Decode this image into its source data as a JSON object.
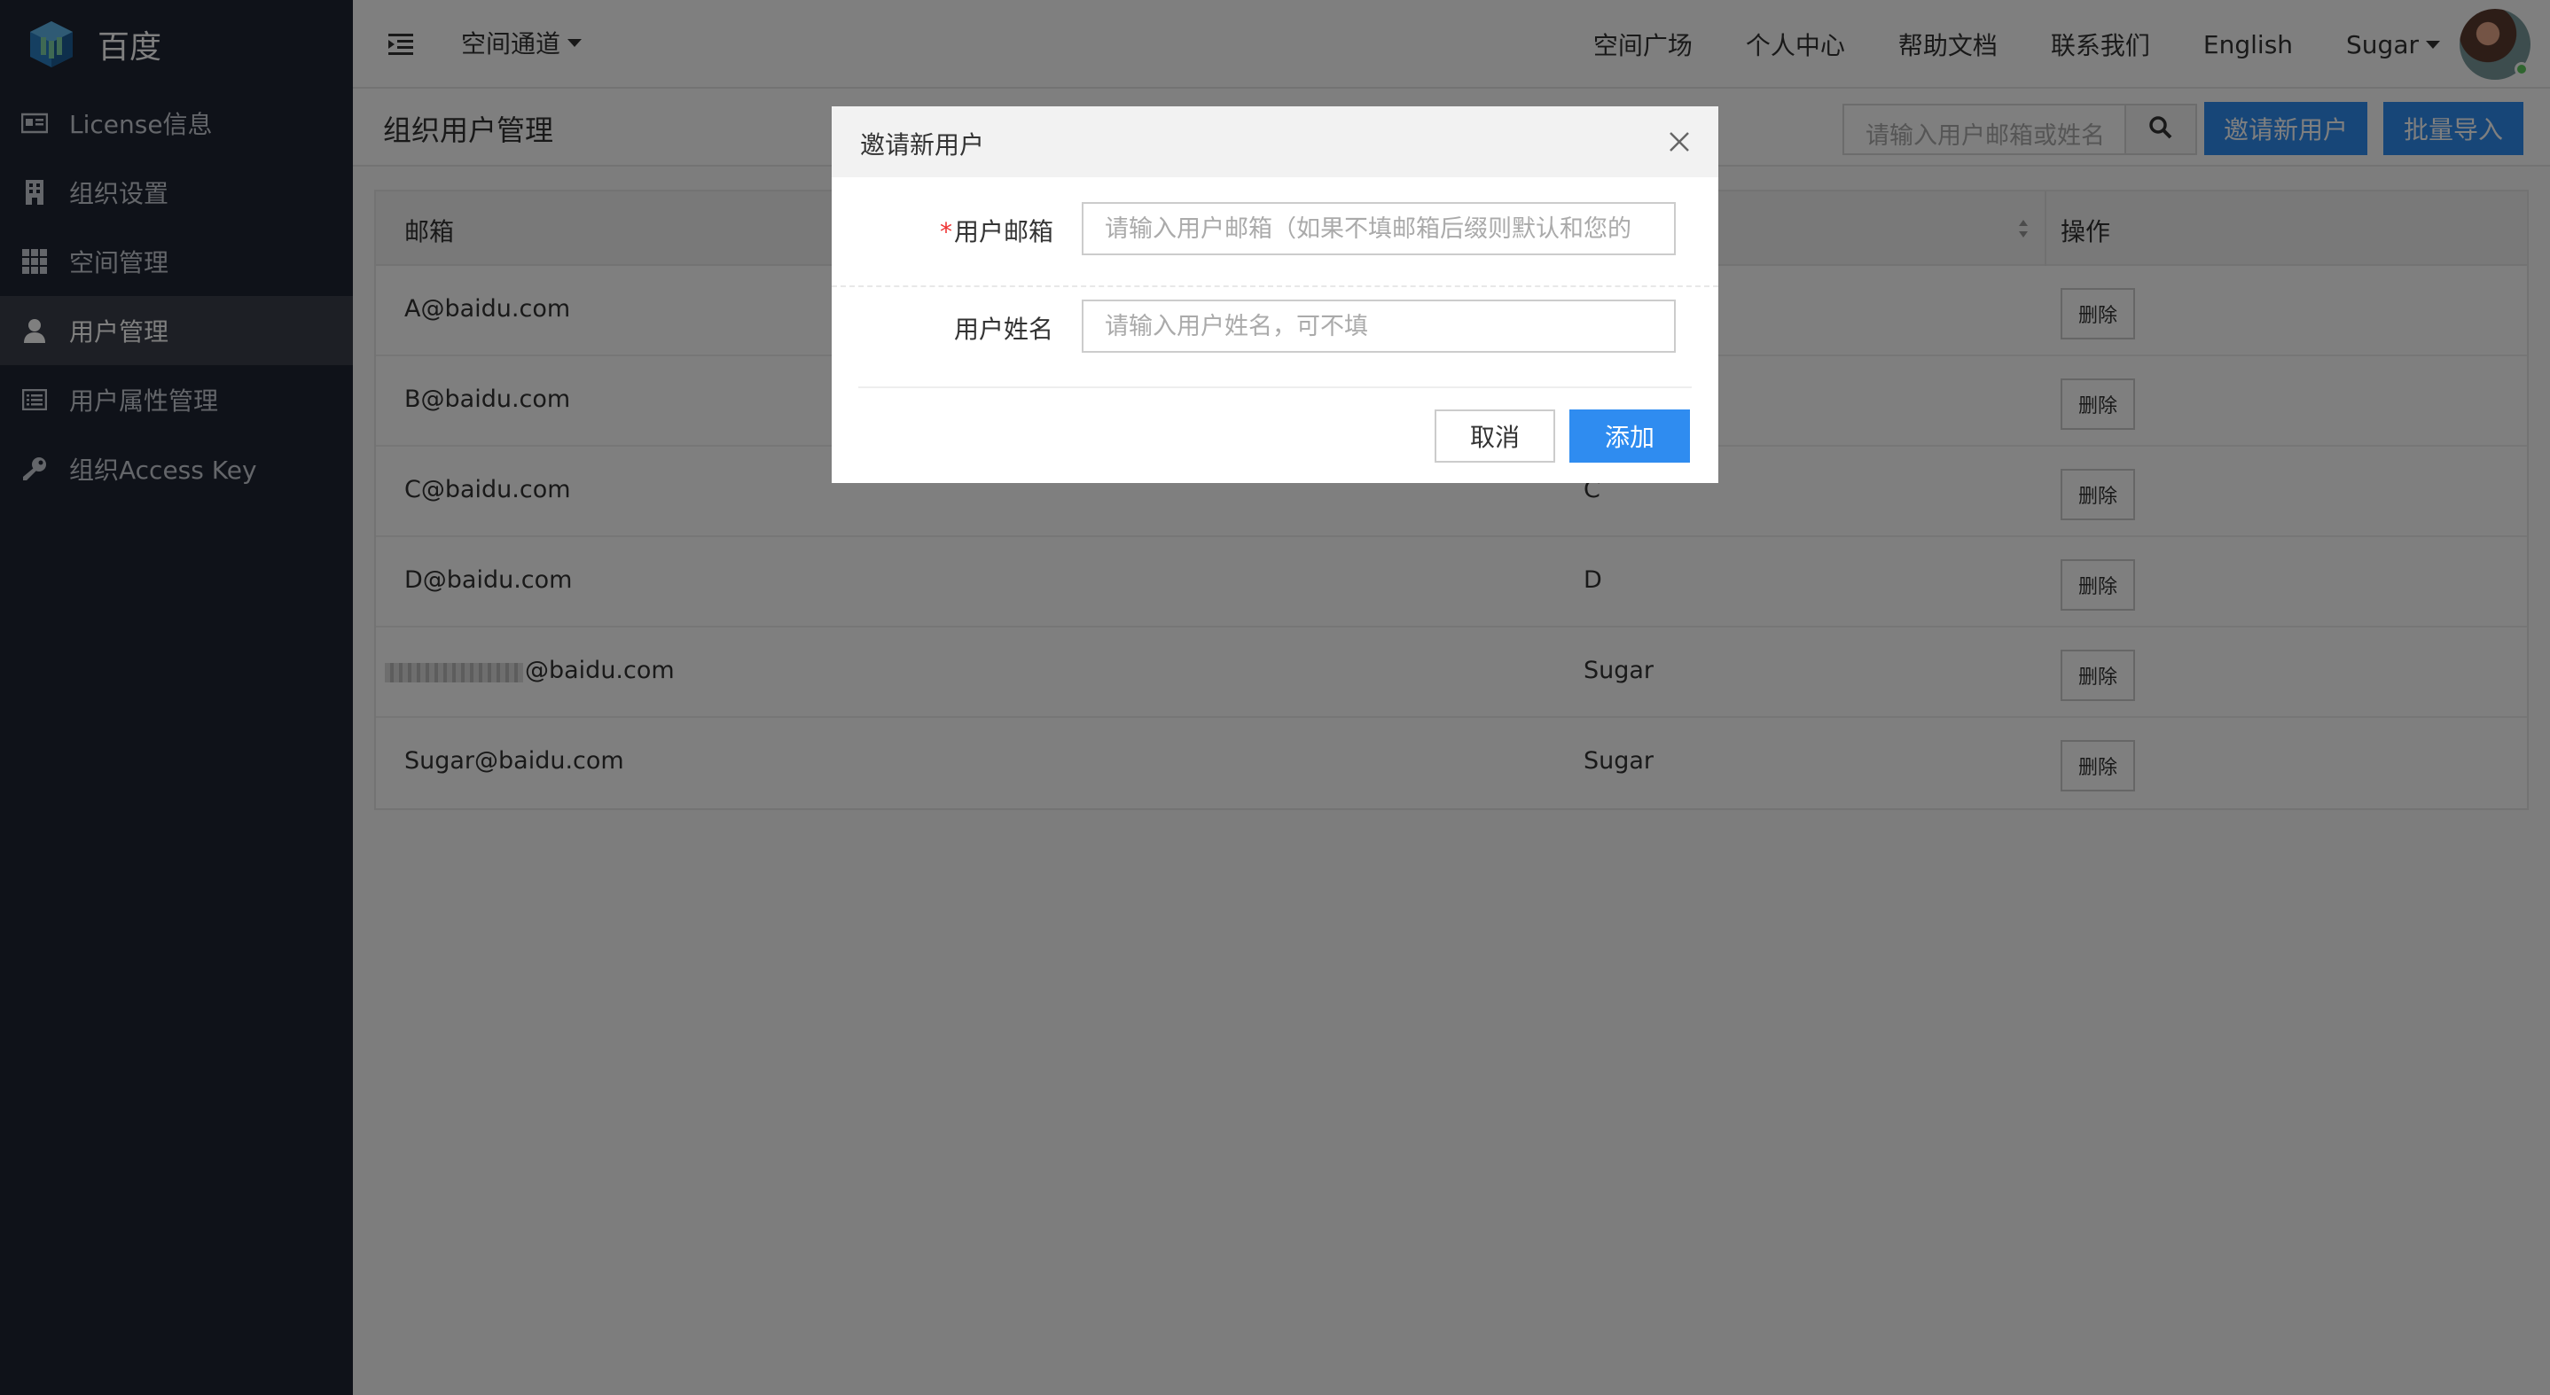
{
  "brand": {
    "name": "百度"
  },
  "sidebar": {
    "items": [
      {
        "label": "License信息",
        "icon": "id-card-icon"
      },
      {
        "label": "组织设置",
        "icon": "building-icon"
      },
      {
        "label": "空间管理",
        "icon": "grid-icon"
      },
      {
        "label": "用户管理",
        "icon": "user-icon",
        "active": true
      },
      {
        "label": "用户属性管理",
        "icon": "list-icon"
      },
      {
        "label": "组织Access Key",
        "icon": "key-icon"
      }
    ]
  },
  "topbar": {
    "space_select": "空间通道",
    "links": [
      "空间广场",
      "个人中心",
      "帮助文档",
      "联系我们",
      "English"
    ],
    "user": "Sugar"
  },
  "page": {
    "title": "组织用户管理",
    "search_placeholder": "请输入用户邮箱或姓名",
    "invite_label": "邀请新用户",
    "import_label": "批量导入"
  },
  "table": {
    "columns": [
      "邮箱",
      "操作"
    ],
    "delete_label": "删除",
    "rows": [
      {
        "email": "A@baidu.com",
        "name": ""
      },
      {
        "email": "B@baidu.com",
        "name": ""
      },
      {
        "email": "C@baidu.com",
        "name": "C"
      },
      {
        "email": "D@baidu.com",
        "name": "D"
      },
      {
        "email": "@baidu.com",
        "name": "Sugar",
        "masked": true
      },
      {
        "email": "Sugar@baidu.com",
        "name": "Sugar"
      }
    ]
  },
  "modal": {
    "title": "邀请新用户",
    "email_label": "用户邮箱",
    "email_required_mark": "*",
    "email_placeholder": "请输入用户邮箱（如果不填邮箱后缀则默认和您的",
    "name_label": "用户姓名",
    "name_placeholder": "请输入用户姓名，可不填",
    "cancel_label": "取消",
    "add_label": "添加"
  },
  "colors": {
    "primary": "#2f8cf0",
    "sidebar": "#1f2532",
    "required": "#e33333"
  }
}
